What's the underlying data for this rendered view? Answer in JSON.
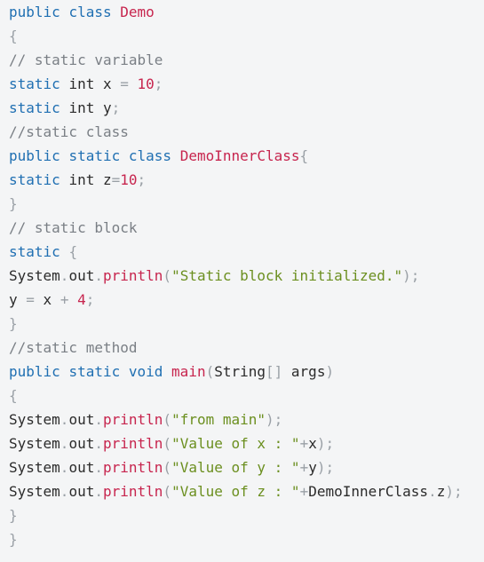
{
  "code_lines": [
    [
      {
        "t": "public",
        "c": "kw"
      },
      {
        "t": " ",
        "c": "id"
      },
      {
        "t": "class",
        "c": "kw"
      },
      {
        "t": " ",
        "c": "id"
      },
      {
        "t": "Demo",
        "c": "cls"
      }
    ],
    [
      {
        "t": "{",
        "c": "pun"
      }
    ],
    [
      {
        "t": "// static variable",
        "c": "com"
      }
    ],
    [
      {
        "t": "static",
        "c": "kw"
      },
      {
        "t": " ",
        "c": "id"
      },
      {
        "t": "int",
        "c": "id"
      },
      {
        "t": " x ",
        "c": "id"
      },
      {
        "t": "=",
        "c": "pun"
      },
      {
        "t": " ",
        "c": "id"
      },
      {
        "t": "10",
        "c": "num"
      },
      {
        "t": ";",
        "c": "pun"
      }
    ],
    [
      {
        "t": "static",
        "c": "kw"
      },
      {
        "t": " ",
        "c": "id"
      },
      {
        "t": "int",
        "c": "id"
      },
      {
        "t": " y",
        "c": "id"
      },
      {
        "t": ";",
        "c": "pun"
      }
    ],
    [
      {
        "t": "//static class",
        "c": "com"
      }
    ],
    [
      {
        "t": "public",
        "c": "kw"
      },
      {
        "t": " ",
        "c": "id"
      },
      {
        "t": "static",
        "c": "kw"
      },
      {
        "t": " ",
        "c": "id"
      },
      {
        "t": "class",
        "c": "kw"
      },
      {
        "t": " ",
        "c": "id"
      },
      {
        "t": "DemoInnerClass",
        "c": "cls"
      },
      {
        "t": "{",
        "c": "pun"
      }
    ],
    [
      {
        "t": "static",
        "c": "kw"
      },
      {
        "t": " ",
        "c": "id"
      },
      {
        "t": "int",
        "c": "id"
      },
      {
        "t": " z",
        "c": "id"
      },
      {
        "t": "=",
        "c": "pun"
      },
      {
        "t": "10",
        "c": "num"
      },
      {
        "t": ";",
        "c": "pun"
      }
    ],
    [
      {
        "t": "}",
        "c": "pun"
      }
    ],
    [
      {
        "t": "// static block",
        "c": "com"
      }
    ],
    [
      {
        "t": "static",
        "c": "kw"
      },
      {
        "t": " ",
        "c": "id"
      },
      {
        "t": "{",
        "c": "pun"
      }
    ],
    [
      {
        "t": "System",
        "c": "id"
      },
      {
        "t": ".",
        "c": "pun"
      },
      {
        "t": "out",
        "c": "id"
      },
      {
        "t": ".",
        "c": "pun"
      },
      {
        "t": "println",
        "c": "cls"
      },
      {
        "t": "(",
        "c": "pun"
      },
      {
        "t": "\"Static block initialized.\"",
        "c": "str"
      },
      {
        "t": ");",
        "c": "pun"
      }
    ],
    [
      {
        "t": "y ",
        "c": "id"
      },
      {
        "t": "=",
        "c": "pun"
      },
      {
        "t": " x ",
        "c": "id"
      },
      {
        "t": "+",
        "c": "pun"
      },
      {
        "t": " ",
        "c": "id"
      },
      {
        "t": "4",
        "c": "num"
      },
      {
        "t": ";",
        "c": "pun"
      }
    ],
    [
      {
        "t": "}",
        "c": "pun"
      }
    ],
    [
      {
        "t": "//static method",
        "c": "com"
      }
    ],
    [
      {
        "t": "public",
        "c": "kw"
      },
      {
        "t": " ",
        "c": "id"
      },
      {
        "t": "static",
        "c": "kw"
      },
      {
        "t": " ",
        "c": "id"
      },
      {
        "t": "void",
        "c": "kw"
      },
      {
        "t": " ",
        "c": "id"
      },
      {
        "t": "main",
        "c": "cls"
      },
      {
        "t": "(",
        "c": "pun"
      },
      {
        "t": "String",
        "c": "id"
      },
      {
        "t": "[]",
        "c": "pun"
      },
      {
        "t": " args",
        "c": "id"
      },
      {
        "t": ")",
        "c": "pun"
      }
    ],
    [
      {
        "t": "{",
        "c": "pun"
      }
    ],
    [
      {
        "t": "System",
        "c": "id"
      },
      {
        "t": ".",
        "c": "pun"
      },
      {
        "t": "out",
        "c": "id"
      },
      {
        "t": ".",
        "c": "pun"
      },
      {
        "t": "println",
        "c": "cls"
      },
      {
        "t": "(",
        "c": "pun"
      },
      {
        "t": "\"from main\"",
        "c": "str"
      },
      {
        "t": ");",
        "c": "pun"
      }
    ],
    [
      {
        "t": "System",
        "c": "id"
      },
      {
        "t": ".",
        "c": "pun"
      },
      {
        "t": "out",
        "c": "id"
      },
      {
        "t": ".",
        "c": "pun"
      },
      {
        "t": "println",
        "c": "cls"
      },
      {
        "t": "(",
        "c": "pun"
      },
      {
        "t": "\"Value of x : \"",
        "c": "str"
      },
      {
        "t": "+",
        "c": "pun"
      },
      {
        "t": "x",
        "c": "id"
      },
      {
        "t": ");",
        "c": "pun"
      }
    ],
    [
      {
        "t": "System",
        "c": "id"
      },
      {
        "t": ".",
        "c": "pun"
      },
      {
        "t": "out",
        "c": "id"
      },
      {
        "t": ".",
        "c": "pun"
      },
      {
        "t": "println",
        "c": "cls"
      },
      {
        "t": "(",
        "c": "pun"
      },
      {
        "t": "\"Value of y : \"",
        "c": "str"
      },
      {
        "t": "+",
        "c": "pun"
      },
      {
        "t": "y",
        "c": "id"
      },
      {
        "t": ");",
        "c": "pun"
      }
    ],
    [
      {
        "t": "System",
        "c": "id"
      },
      {
        "t": ".",
        "c": "pun"
      },
      {
        "t": "out",
        "c": "id"
      },
      {
        "t": ".",
        "c": "pun"
      },
      {
        "t": "println",
        "c": "cls"
      },
      {
        "t": "(",
        "c": "pun"
      },
      {
        "t": "\"Value of z : \"",
        "c": "str"
      },
      {
        "t": "+",
        "c": "pun"
      },
      {
        "t": "DemoInnerClass",
        "c": "id"
      },
      {
        "t": ".",
        "c": "pun"
      },
      {
        "t": "z",
        "c": "id"
      },
      {
        "t": ");",
        "c": "pun"
      }
    ],
    [
      {
        "t": "}",
        "c": "pun"
      }
    ],
    [
      {
        "t": "}",
        "c": "pun"
      }
    ]
  ]
}
